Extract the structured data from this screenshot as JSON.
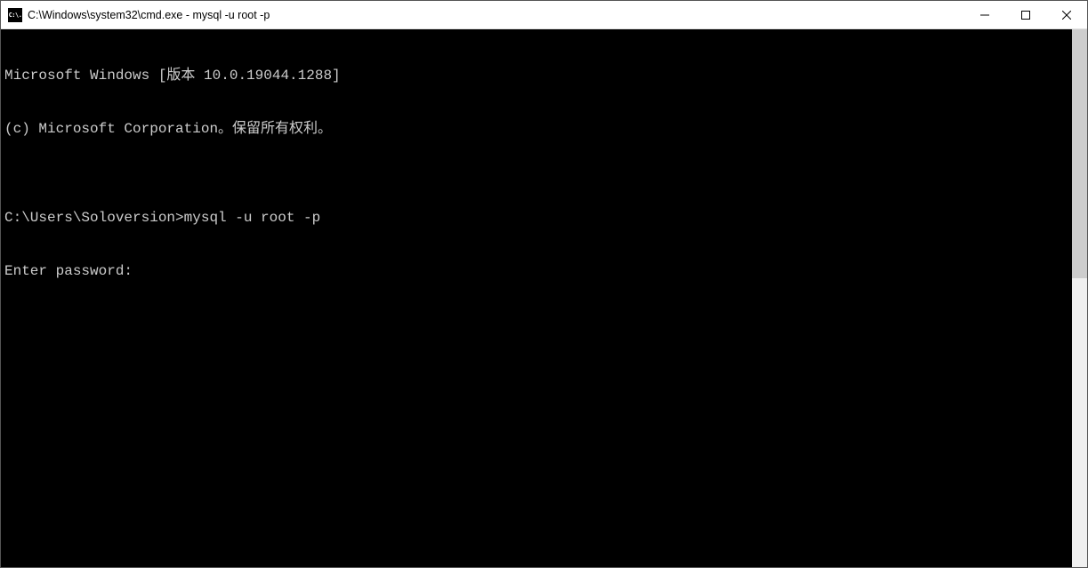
{
  "window": {
    "icon_label": "C:\\.",
    "title": "C:\\Windows\\system32\\cmd.exe - mysql  -u root -p"
  },
  "terminal": {
    "lines": [
      "Microsoft Windows [版本 10.0.19044.1288]",
      "(c) Microsoft Corporation。保留所有权利。",
      "",
      "C:\\Users\\Soloversion>mysql -u root -p",
      "Enter password:"
    ]
  }
}
